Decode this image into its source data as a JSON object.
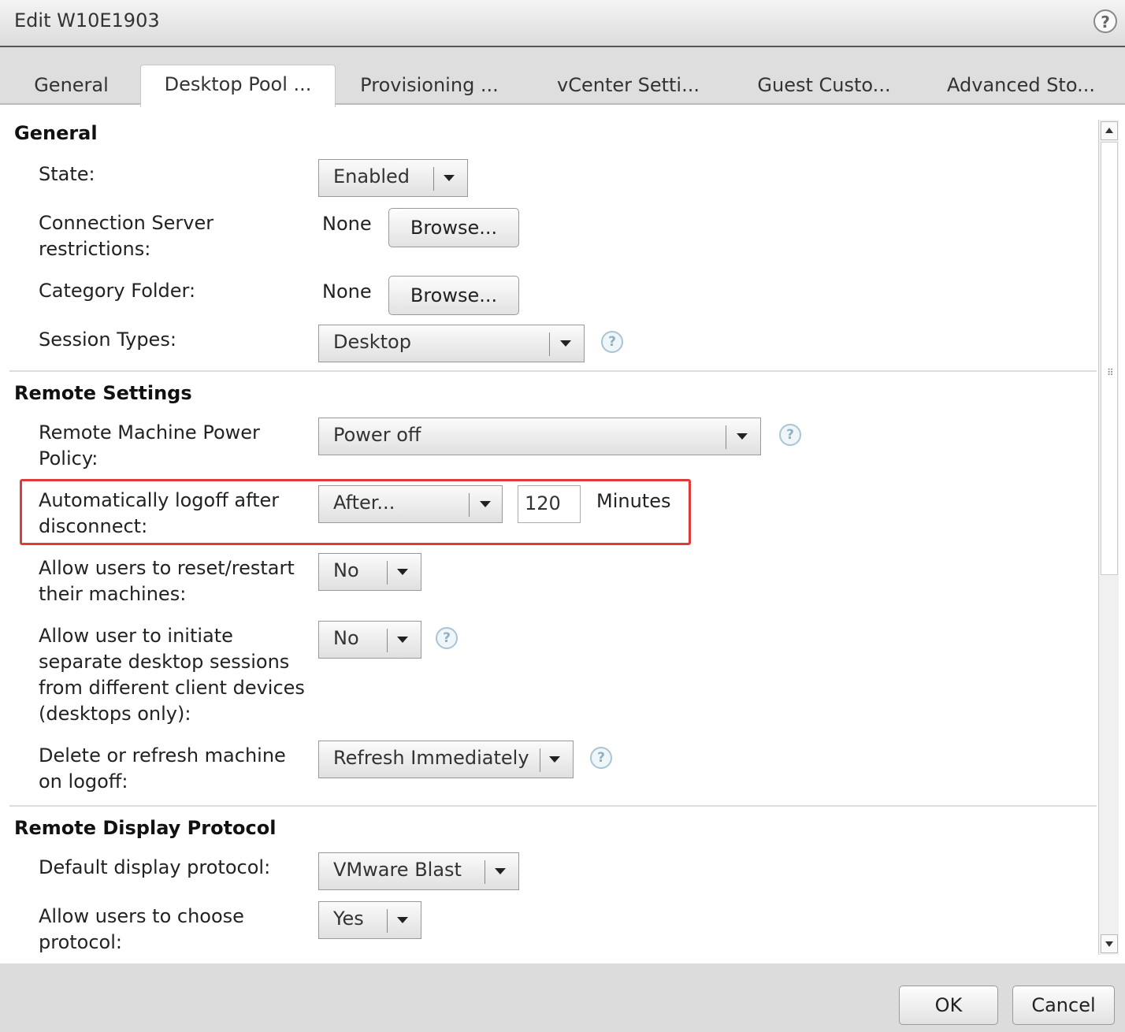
{
  "window": {
    "title": "Edit W10E1903",
    "help_glyph": "?"
  },
  "tabs": [
    {
      "label": "General"
    },
    {
      "label": "Desktop Pool ...",
      "active": true
    },
    {
      "label": "Provisioning ..."
    },
    {
      "label": "vCenter Setti..."
    },
    {
      "label": "Guest Custo..."
    },
    {
      "label": "Advanced Sto..."
    }
  ],
  "general": {
    "title": "General",
    "state_label": "State:",
    "state_value": "Enabled",
    "conn_server_label": "Connection Server restrictions:",
    "conn_server_value": "None",
    "conn_server_browse": "Browse...",
    "category_label": "Category Folder:",
    "category_value": "None",
    "category_browse": "Browse...",
    "session_types_label": "Session Types:",
    "session_types_value": "Desktop"
  },
  "remote": {
    "title": "Remote Settings",
    "power_policy_label": "Remote Machine Power Policy:",
    "power_policy_value": "Power off",
    "logoff_label": "Automatically logoff after disconnect:",
    "logoff_value": "After...",
    "logoff_minutes": "120",
    "logoff_unit": "Minutes",
    "reset_label": "Allow users to reset/restart their machines:",
    "reset_value": "No",
    "separate_label": "Allow user to initiate separate desktop sessions from different client devices (desktops only):",
    "separate_value": "No",
    "delete_label": "Delete or refresh machine on logoff:",
    "delete_value": "Refresh Immediately"
  },
  "display": {
    "title": "Remote Display Protocol",
    "default_label": "Default display protocol:",
    "default_value": "VMware Blast",
    "choose_label": "Allow users to choose protocol:",
    "choose_value": "Yes"
  },
  "footer": {
    "ok": "OK",
    "cancel": "Cancel"
  },
  "help_icon_glyph": "?",
  "colors": {
    "highlight": "#e03b3b",
    "help_icon": "#8fb0c2"
  }
}
